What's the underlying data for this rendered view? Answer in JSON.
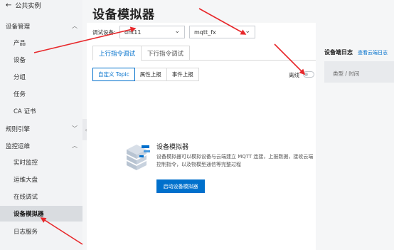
{
  "sidebar": {
    "back_label": "公共实例",
    "groups": [
      {
        "label": "设备管理",
        "expanded": true
      },
      {
        "label": "规则引擎",
        "expanded": false
      },
      {
        "label": "监控运维",
        "expanded": true
      }
    ],
    "device_items": [
      "产品",
      "设备",
      "分组",
      "任务",
      "CA 证书"
    ],
    "ops_items": [
      "实时监控",
      "运维大盘",
      "在线调试",
      "设备模拟器",
      "日志服务"
    ],
    "active_item": "设备模拟器"
  },
  "main": {
    "title": "设备模拟器",
    "debug_device_label": "调试设备:",
    "product_select": "dht11",
    "device_select": "mqtt_fx",
    "tabs": [
      "上行指令调试",
      "下行指令调试"
    ],
    "subtabs": [
      "自定义 Topic",
      "属性上报",
      "事件上报"
    ],
    "status_label": "离线",
    "empty": {
      "title": "设备模拟器",
      "description": "设备模拟器可以模拟设备与云端建立 MQTT 连接，上报数据，接收云端控制指令，以及物模型通信等完整过程",
      "button": "启动设备模拟器"
    }
  },
  "log_panel": {
    "title": "设备端日志",
    "link": "查看云端日志",
    "column": "类型 / 时间"
  },
  "colors": {
    "accent": "#0070cc",
    "annotation": "#e8282b"
  }
}
